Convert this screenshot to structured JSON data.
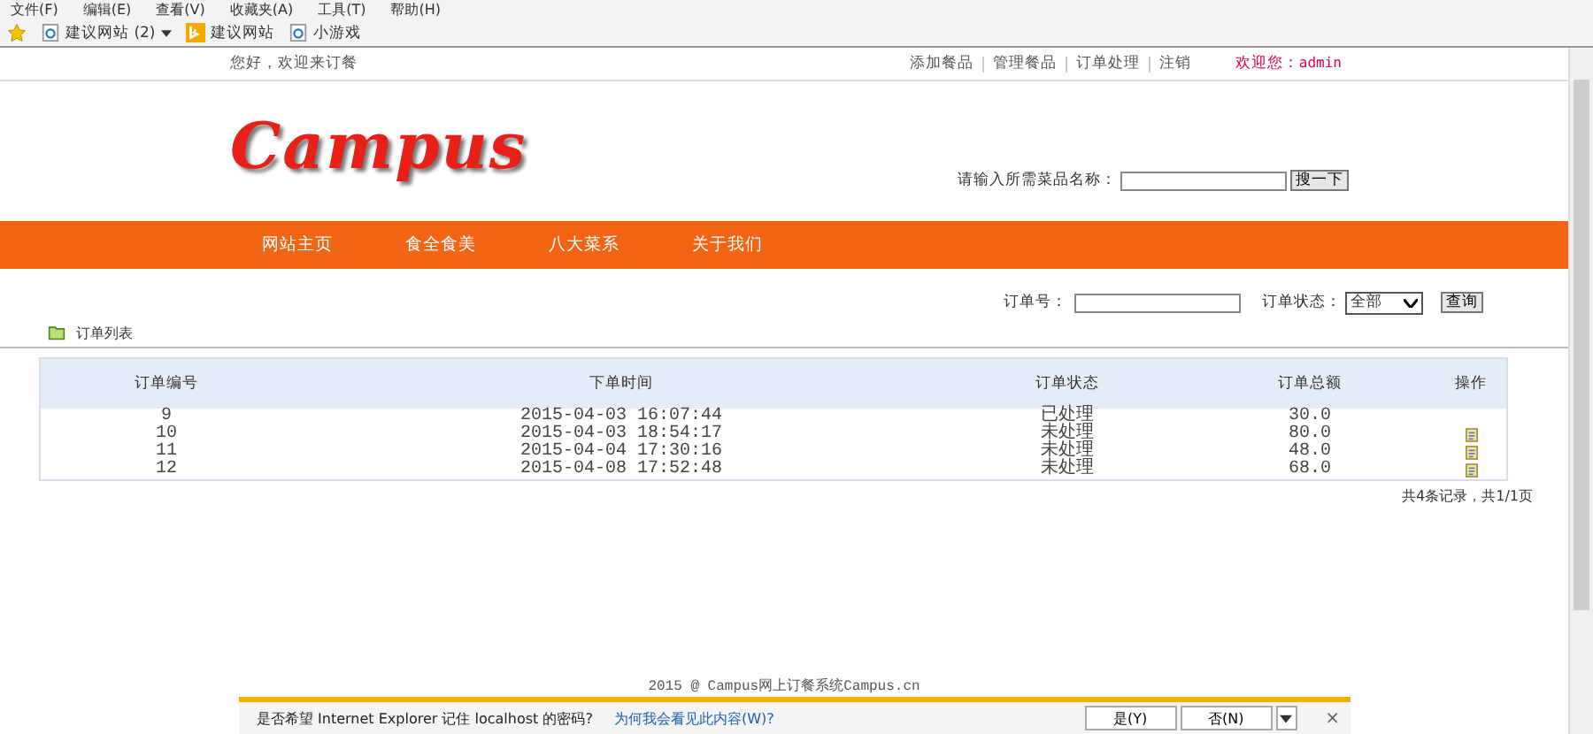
{
  "browser": {
    "menu": [
      "文件(F)",
      "编辑(E)",
      "查看(V)",
      "收藏夹(A)",
      "工具(T)",
      "帮助(H)"
    ],
    "favorites": [
      {
        "label": "建议网站 (2)",
        "kind": "page",
        "dropdown": true
      },
      {
        "label": "建议网站",
        "kind": "logo",
        "dropdown": false
      },
      {
        "label": "小游戏",
        "kind": "page",
        "dropdown": false
      }
    ]
  },
  "topbar": {
    "greeting": "您好，欢迎来订餐",
    "links": [
      "添加餐品",
      "管理餐品",
      "订单处理",
      "注销"
    ],
    "welcome_label": "欢迎您：",
    "user": "admin"
  },
  "header": {
    "logo": "Campus",
    "search_label": "请输入所需菜品名称：",
    "search_button": "搜一下"
  },
  "nav": [
    "网站主页",
    "食全食美",
    "八大菜系",
    "关于我们"
  ],
  "filter": {
    "order_no_label": "订单号：",
    "status_label": "订单状态：",
    "status_value": "全部",
    "button": "查询"
  },
  "list_title": "订单列表",
  "table": {
    "columns": [
      "订单编号",
      "下单时间",
      "订单状态",
      "订单总额",
      "操作"
    ],
    "rows": [
      {
        "cells": [
          "9",
          "2015-04-03 16:07:44",
          "已处理",
          "30.0"
        ],
        "edit": false
      },
      {
        "cells": [
          "10",
          "2015-04-03 18:54:17",
          "未处理",
          "80.0"
        ],
        "edit": true
      },
      {
        "cells": [
          "11",
          "2015-04-04 17:30:16",
          "未处理",
          "48.0"
        ],
        "edit": true
      },
      {
        "cells": [
          "12",
          "2015-04-08 17:52:48",
          "未处理",
          "68.0"
        ],
        "edit": true
      }
    ]
  },
  "pagination": "共4条记录，共1/1页",
  "footer": "2015 @ Campus网上订餐系统Campus.cn",
  "notification": {
    "message": "是否希望 Internet Explorer 记住 localhost 的密码?",
    "link": "为何我会看见此内容(W)?",
    "buttons": [
      "是(Y)",
      "否(N)"
    ],
    "close": "×"
  }
}
